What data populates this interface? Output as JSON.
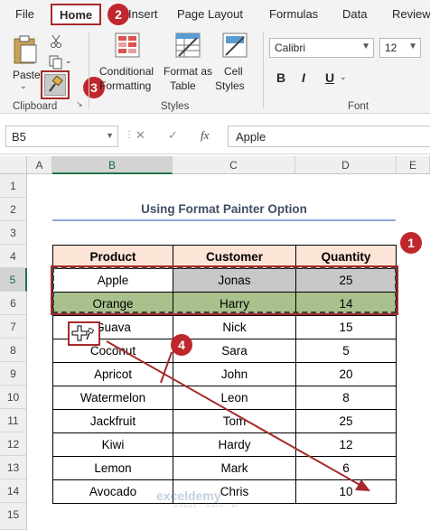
{
  "ribbon": {
    "tabs": [
      "File",
      "Home",
      "Insert",
      "Page Layout",
      "Formulas",
      "Data",
      "Review"
    ],
    "paste_label": "Paste",
    "conditional_formatting_label": [
      "Conditional",
      "Formatting"
    ],
    "format_as_table_label": [
      "Format as",
      "Table"
    ],
    "cell_styles_label": [
      "Cell",
      "Styles"
    ],
    "groups": {
      "clipboard": "Clipboard",
      "styles": "Styles",
      "font": "Font"
    },
    "font_name": "Calibri",
    "font_size": "12",
    "format_buttons": [
      "B",
      "I",
      "U"
    ]
  },
  "formula_bar": {
    "name_box": "B5",
    "cancel_glyph": "✕",
    "enter_glyph": "✓",
    "fx_label": "fx",
    "content": "Apple"
  },
  "grid": {
    "columns": [
      "A",
      "B",
      "C",
      "D",
      "E"
    ],
    "selected_column": "B",
    "rows": [
      "1",
      "2",
      "3",
      "4",
      "5",
      "6",
      "7",
      "8",
      "9",
      "10",
      "11",
      "12",
      "13",
      "14",
      "15"
    ],
    "selected_row": "5",
    "sheet_title": "Using Format Painter Option"
  },
  "table": {
    "headers": [
      "Product",
      "Customer",
      "Quantity"
    ],
    "rows": [
      [
        "Apple",
        "Jonas",
        "25"
      ],
      [
        "Orange",
        "Harry",
        "14"
      ],
      [
        "Guava",
        "Nick",
        "15"
      ],
      [
        "Coconut",
        "Sara",
        "5"
      ],
      [
        "Apricot",
        "John",
        "20"
      ],
      [
        "Watermelon",
        "Leon",
        "8"
      ],
      [
        "Jackfruit",
        "Tom",
        "25"
      ],
      [
        "Kiwi",
        "Hardy",
        "12"
      ],
      [
        "Lemon",
        "Mark",
        "6"
      ],
      [
        "Avocado",
        "Chris",
        "10"
      ]
    ]
  },
  "annotations": [
    "1",
    "2",
    "3",
    "4"
  ],
  "watermark": {
    "name": "exceldemy",
    "tagline": "EXCEL · DATA · BI"
  },
  "colors": {
    "header_fill": "#fce4d6",
    "apple_fill": "#c8c8c8",
    "orange_fill": "#a9c18c",
    "annotation_red": "#c0272d",
    "excel_green": "#217346"
  }
}
